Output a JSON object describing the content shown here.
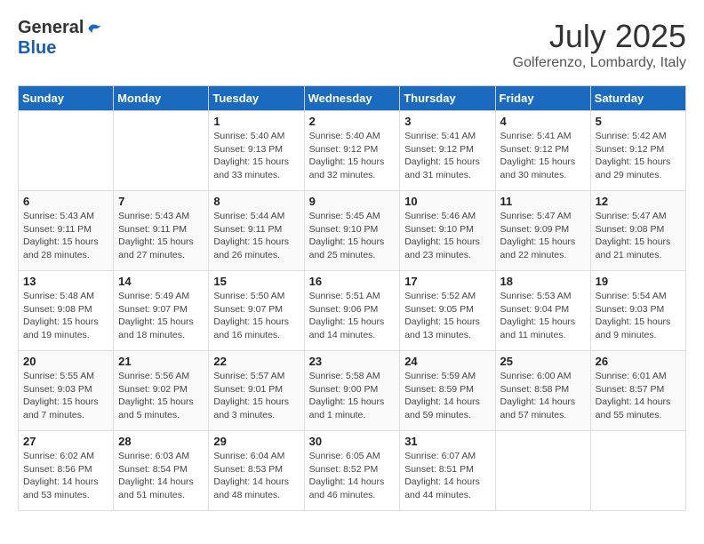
{
  "header": {
    "logo_general": "General",
    "logo_blue": "Blue",
    "month_title": "July 2025",
    "location": "Golferenzo, Lombardy, Italy"
  },
  "weekdays": [
    "Sunday",
    "Monday",
    "Tuesday",
    "Wednesday",
    "Thursday",
    "Friday",
    "Saturday"
  ],
  "weeks": [
    [
      {
        "day": "",
        "detail": ""
      },
      {
        "day": "",
        "detail": ""
      },
      {
        "day": "1",
        "detail": "Sunrise: 5:40 AM\nSunset: 9:13 PM\nDaylight: 15 hours\nand 33 minutes."
      },
      {
        "day": "2",
        "detail": "Sunrise: 5:40 AM\nSunset: 9:12 PM\nDaylight: 15 hours\nand 32 minutes."
      },
      {
        "day": "3",
        "detail": "Sunrise: 5:41 AM\nSunset: 9:12 PM\nDaylight: 15 hours\nand 31 minutes."
      },
      {
        "day": "4",
        "detail": "Sunrise: 5:41 AM\nSunset: 9:12 PM\nDaylight: 15 hours\nand 30 minutes."
      },
      {
        "day": "5",
        "detail": "Sunrise: 5:42 AM\nSunset: 9:12 PM\nDaylight: 15 hours\nand 29 minutes."
      }
    ],
    [
      {
        "day": "6",
        "detail": "Sunrise: 5:43 AM\nSunset: 9:11 PM\nDaylight: 15 hours\nand 28 minutes."
      },
      {
        "day": "7",
        "detail": "Sunrise: 5:43 AM\nSunset: 9:11 PM\nDaylight: 15 hours\nand 27 minutes."
      },
      {
        "day": "8",
        "detail": "Sunrise: 5:44 AM\nSunset: 9:11 PM\nDaylight: 15 hours\nand 26 minutes."
      },
      {
        "day": "9",
        "detail": "Sunrise: 5:45 AM\nSunset: 9:10 PM\nDaylight: 15 hours\nand 25 minutes."
      },
      {
        "day": "10",
        "detail": "Sunrise: 5:46 AM\nSunset: 9:10 PM\nDaylight: 15 hours\nand 23 minutes."
      },
      {
        "day": "11",
        "detail": "Sunrise: 5:47 AM\nSunset: 9:09 PM\nDaylight: 15 hours\nand 22 minutes."
      },
      {
        "day": "12",
        "detail": "Sunrise: 5:47 AM\nSunset: 9:08 PM\nDaylight: 15 hours\nand 21 minutes."
      }
    ],
    [
      {
        "day": "13",
        "detail": "Sunrise: 5:48 AM\nSunset: 9:08 PM\nDaylight: 15 hours\nand 19 minutes."
      },
      {
        "day": "14",
        "detail": "Sunrise: 5:49 AM\nSunset: 9:07 PM\nDaylight: 15 hours\nand 18 minutes."
      },
      {
        "day": "15",
        "detail": "Sunrise: 5:50 AM\nSunset: 9:07 PM\nDaylight: 15 hours\nand 16 minutes."
      },
      {
        "day": "16",
        "detail": "Sunrise: 5:51 AM\nSunset: 9:06 PM\nDaylight: 15 hours\nand 14 minutes."
      },
      {
        "day": "17",
        "detail": "Sunrise: 5:52 AM\nSunset: 9:05 PM\nDaylight: 15 hours\nand 13 minutes."
      },
      {
        "day": "18",
        "detail": "Sunrise: 5:53 AM\nSunset: 9:04 PM\nDaylight: 15 hours\nand 11 minutes."
      },
      {
        "day": "19",
        "detail": "Sunrise: 5:54 AM\nSunset: 9:03 PM\nDaylight: 15 hours\nand 9 minutes."
      }
    ],
    [
      {
        "day": "20",
        "detail": "Sunrise: 5:55 AM\nSunset: 9:03 PM\nDaylight: 15 hours\nand 7 minutes."
      },
      {
        "day": "21",
        "detail": "Sunrise: 5:56 AM\nSunset: 9:02 PM\nDaylight: 15 hours\nand 5 minutes."
      },
      {
        "day": "22",
        "detail": "Sunrise: 5:57 AM\nSunset: 9:01 PM\nDaylight: 15 hours\nand 3 minutes."
      },
      {
        "day": "23",
        "detail": "Sunrise: 5:58 AM\nSunset: 9:00 PM\nDaylight: 15 hours\nand 1 minute."
      },
      {
        "day": "24",
        "detail": "Sunrise: 5:59 AM\nSunset: 8:59 PM\nDaylight: 14 hours\nand 59 minutes."
      },
      {
        "day": "25",
        "detail": "Sunrise: 6:00 AM\nSunset: 8:58 PM\nDaylight: 14 hours\nand 57 minutes."
      },
      {
        "day": "26",
        "detail": "Sunrise: 6:01 AM\nSunset: 8:57 PM\nDaylight: 14 hours\nand 55 minutes."
      }
    ],
    [
      {
        "day": "27",
        "detail": "Sunrise: 6:02 AM\nSunset: 8:56 PM\nDaylight: 14 hours\nand 53 minutes."
      },
      {
        "day": "28",
        "detail": "Sunrise: 6:03 AM\nSunset: 8:54 PM\nDaylight: 14 hours\nand 51 minutes."
      },
      {
        "day": "29",
        "detail": "Sunrise: 6:04 AM\nSunset: 8:53 PM\nDaylight: 14 hours\nand 48 minutes."
      },
      {
        "day": "30",
        "detail": "Sunrise: 6:05 AM\nSunset: 8:52 PM\nDaylight: 14 hours\nand 46 minutes."
      },
      {
        "day": "31",
        "detail": "Sunrise: 6:07 AM\nSunset: 8:51 PM\nDaylight: 14 hours\nand 44 minutes."
      },
      {
        "day": "",
        "detail": ""
      },
      {
        "day": "",
        "detail": ""
      }
    ]
  ]
}
